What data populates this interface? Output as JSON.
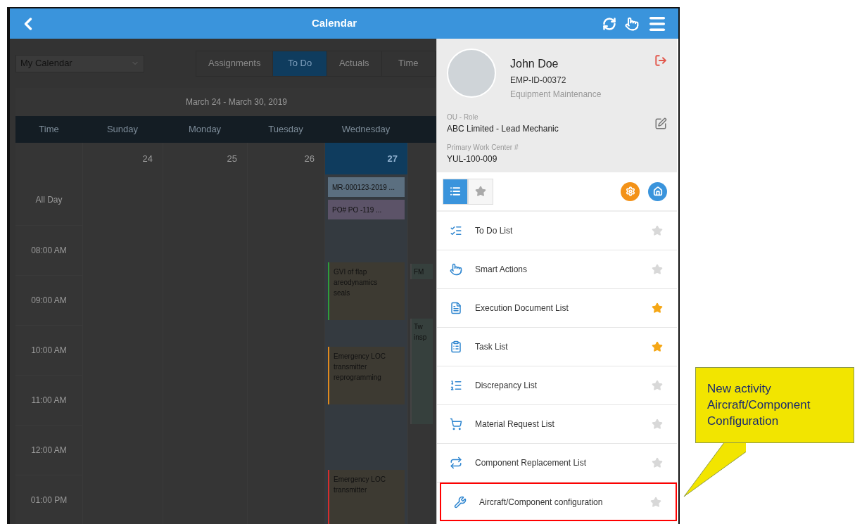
{
  "header": {
    "title": "Calendar"
  },
  "calendar": {
    "selector": "My Calendar",
    "tabs": [
      {
        "label": "Assignments",
        "selected": false
      },
      {
        "label": "To Do",
        "selected": true
      },
      {
        "label": "Actuals",
        "selected": false
      },
      {
        "label": "Time",
        "selected": false
      }
    ],
    "range": "March 24 - March 30, 2019",
    "columns": [
      "Time",
      "Sunday",
      "Monday",
      "Tuesday",
      "Wednesday"
    ],
    "dates": [
      {
        "label": "24",
        "selected": false
      },
      {
        "label": "25",
        "selected": false
      },
      {
        "label": "26",
        "selected": false
      },
      {
        "label": "27",
        "selected": true
      }
    ],
    "all_day_label": "All Day",
    "all_day_events": [
      {
        "label": "MR-000123-2019 ...",
        "color": "#5b6f80"
      },
      {
        "label": "PO# PO -119 ...",
        "color": "#5c5368"
      }
    ],
    "times": [
      "08:00 AM",
      "09:00 AM",
      "10:00 AM",
      "11:00 AM",
      "12:00 AM",
      "01:00 PM"
    ],
    "events": [
      {
        "lines": [
          "GVI of flap",
          "areodynamics",
          "seals"
        ],
        "color": "#2e9d3a"
      },
      {
        "lines": [
          "Emergency LOC",
          "transmitter",
          "reprogramming"
        ],
        "color": "#e08a1e"
      },
      {
        "lines": [
          "Emergency LOC",
          "transmitter"
        ],
        "color": "#d62d2d"
      }
    ],
    "next_day_events": [
      {
        "lines": [
          "FM"
        ]
      },
      {
        "lines": [
          "Tw",
          "insp"
        ]
      }
    ]
  },
  "drawer": {
    "profile": {
      "name": "John Doe",
      "employee_id": "EMP-ID-00372",
      "department": "Equipment Maintenance",
      "role_label": "OU - Role",
      "role": "ABC Limited - Lead Mechanic",
      "work_center_label": "Primary Work Center #",
      "work_center": "YUL-100-009"
    },
    "view_tabs": [
      {
        "kind": "list",
        "selected": true
      },
      {
        "kind": "favorites",
        "selected": false
      }
    ],
    "items": [
      {
        "label": "To Do List",
        "kind": "checklist",
        "favorite": false,
        "highlighted": false
      },
      {
        "label": "Smart Actions",
        "kind": "touch",
        "favorite": false,
        "highlighted": false
      },
      {
        "label": "Execution Document List",
        "kind": "document",
        "favorite": true,
        "highlighted": false
      },
      {
        "label": "Task List",
        "kind": "clipboard",
        "favorite": true,
        "highlighted": false
      },
      {
        "label": "Discrepancy List",
        "kind": "list",
        "favorite": false,
        "highlighted": false
      },
      {
        "label": "Material Request List",
        "kind": "cart",
        "favorite": false,
        "highlighted": false
      },
      {
        "label": "Component Replacement List",
        "kind": "swap",
        "favorite": false,
        "highlighted": false
      },
      {
        "label": "Aircraft/Component configuration",
        "kind": "tools",
        "favorite": false,
        "highlighted": true
      }
    ]
  },
  "callout": {
    "text": "New activity Aircraft/Component Configuration"
  }
}
